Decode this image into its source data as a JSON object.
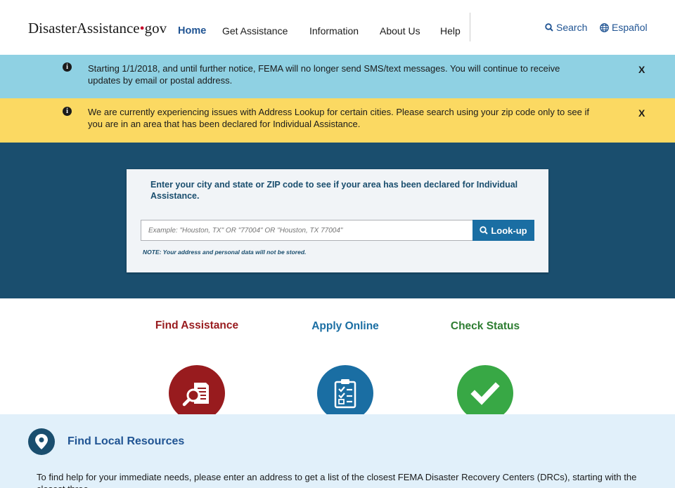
{
  "header": {
    "logo_main": "DisasterAssistance",
    "logo_dot": "•",
    "logo_suffix": "gov",
    "nav": {
      "home": "Home",
      "get_assistance": "Get Assistance",
      "information": "Information",
      "about_us": "About Us",
      "help": "Help"
    },
    "search_label": "Search",
    "language_label": "Español"
  },
  "alerts": [
    {
      "icon": "info-icon",
      "text": "Starting 1/1/2018, and until further notice, FEMA will no longer send SMS/text messages. You will continue to receive updates by email or postal address.",
      "close": "X",
      "color": "#8fd1e3"
    },
    {
      "icon": "info-icon",
      "text": "We are currently experiencing issues with Address Lookup for certain cities.  Please search using your zip code only to see if you are in an area that has been declared for Individual Assistance.",
      "close": "X",
      "color": "#fbd962"
    }
  ],
  "lookup": {
    "prompt": "Enter your city and state or ZIP code to see if your area has been declared for Individual Assistance.",
    "placeholder": "Example: \"Houston, TX\" OR \"77004\" OR \"Houston, TX 77004\"",
    "value": "",
    "button_label": "Look-up",
    "note": "NOTE: Your address and personal data will not be stored."
  },
  "actions": [
    {
      "title": "Find Assistance",
      "icon": "find-assistance-icon",
      "color": "#981b1e"
    },
    {
      "title": "Apply Online",
      "icon": "clipboard-checklist-icon",
      "color": "#1a6ea3"
    },
    {
      "title": "Check Status",
      "icon": "checkmark-icon",
      "color": "#38a845"
    }
  ],
  "local_resources": {
    "title": "Find Local Resources",
    "icon": "map-pin-icon",
    "text": "To find help for your immediate needs, please enter an address to get a list of the closest FEMA Disaster Recovery Centers (DRCs), starting with the closest three."
  },
  "colors": {
    "brand_blue": "#205493",
    "hero_bg": "#1a4e6e",
    "logo_dot": "#c8102e"
  }
}
